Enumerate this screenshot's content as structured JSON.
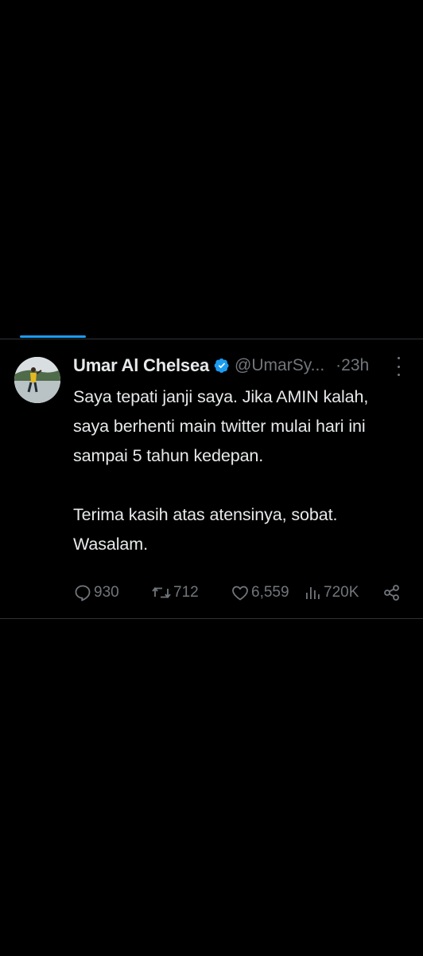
{
  "tweet": {
    "display_name": "Umar Al Chelsea",
    "handle": "@UmarSy...",
    "time": "·23h",
    "body_lines_1": [
      "Saya tepati janji saya. Jika AMIN kalah,",
      "saya berhenti main twitter mulai hari ini",
      "sampai 5 tahun kedepan."
    ],
    "body_line_1a": "Saya tepati janji saya. Jika AMIN kalah,",
    "body_line_1b": "saya berhenti main twitter mulai hari ini",
    "body_line_1c": "sampai 5 tahun kedepan.",
    "body_line_2a": "Terima kasih atas atensinya, sobat.",
    "body_line_2b": "Wasalam.",
    "verified": true
  },
  "stats": {
    "replies": "930",
    "retweets": "712",
    "likes": "6,559",
    "views": "720K"
  },
  "icons": {
    "reply": "reply-icon",
    "retweet": "retweet-icon",
    "like": "heart-icon",
    "views": "views-icon",
    "share": "share-icon",
    "verified": "verified-badge-icon",
    "more": "more-vertical-icon"
  },
  "colors": {
    "background": "#000000",
    "text": "#e7e9ea",
    "secondary": "#71767b",
    "accent": "#1d9bf0",
    "divider": "#2f3336"
  }
}
